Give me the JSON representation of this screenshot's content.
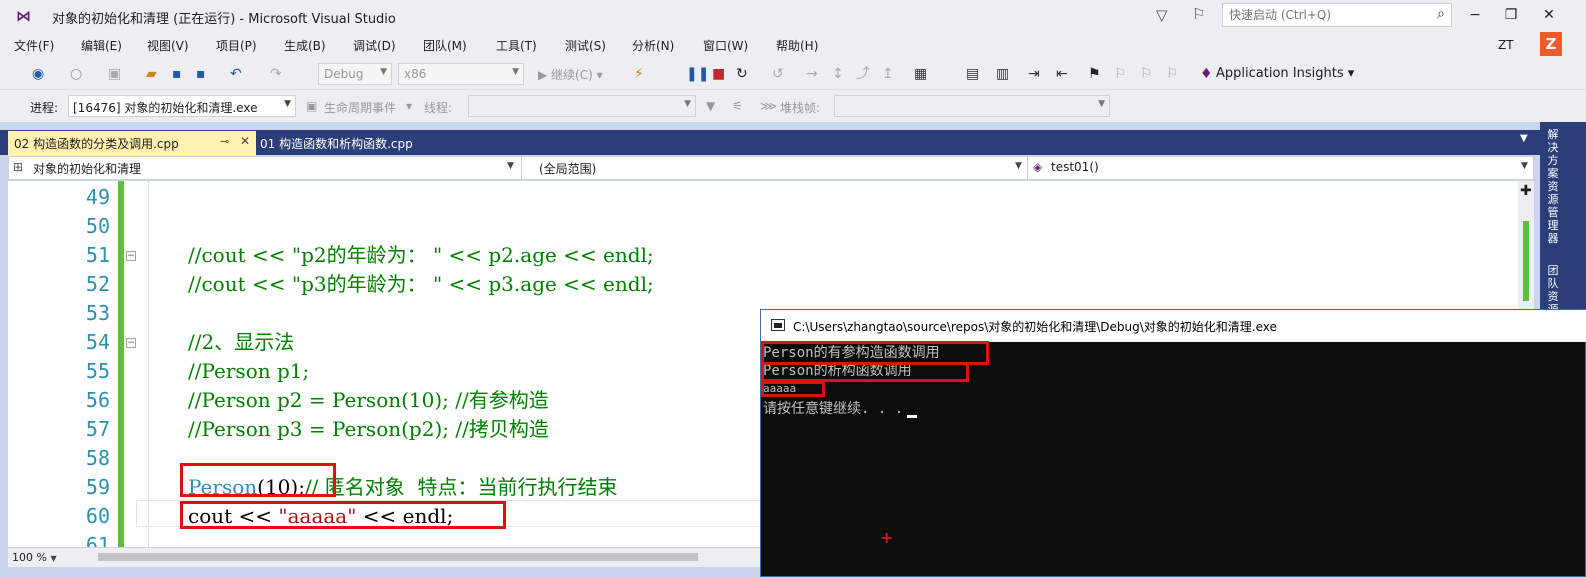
{
  "window": {
    "title": "对象的初始化和清理 (正在运行) - Microsoft Visual Studio",
    "quick_launch_placeholder": "快速启动 (Ctrl+Q)",
    "user_initials": "ZT",
    "user_badge": "Z",
    "minimize": "−",
    "restore": "❐",
    "close": "✕"
  },
  "menu": {
    "items": [
      "文件(F)",
      "编辑(E)",
      "视图(V)",
      "项目(P)",
      "生成(B)",
      "调试(D)",
      "团队(M)",
      "工具(T)",
      "测试(S)",
      "分析(N)",
      "窗口(W)",
      "帮助(H)"
    ]
  },
  "toolbar": {
    "config": "Debug",
    "platform": "x86",
    "continue": "▶ 继续(C) ▾",
    "app_insights": "Application Insights ▾"
  },
  "debug_toolbar": {
    "process_label": "进程:",
    "process_value": "[16476] 对象的初始化和清理.exe",
    "lifecycle_label": "生命周期事件",
    "thread_label": "线程:",
    "stackframe_label": "堆栈帧:"
  },
  "tabs": {
    "active": "02 构造函数的分类及调用.cpp",
    "inactive": "01 构造函数和析构函数.cpp"
  },
  "navbar": {
    "project": "对象的初始化和清理",
    "scope": "(全局范围)",
    "member": "test01()"
  },
  "editor": {
    "line_numbers": [
      "49",
      "50",
      "51",
      "52",
      "53",
      "54",
      "55",
      "56",
      "57",
      "58",
      "59",
      "60",
      "61"
    ],
    "lines": {
      "l51": "//cout << \"p2的年龄为： \" << p2.age << endl;",
      "l52": "//cout << \"p3的年龄为： \" << p3.age << endl;",
      "l54": "//2、显示法",
      "l55": "//Person p1;",
      "l56": "//Person p2 = Person(10); //有参构造",
      "l57": "//Person p3 = Person(p2); //拷贝构造",
      "l59_type": "Person",
      "l59_args": "(10);",
      "l59_comment": "// 匿名对象  特点：当前行执行结束",
      "l60_a": "cout << ",
      "l60_str": "\"aaaaa\"",
      "l60_b": " << endl;"
    },
    "zoom": "100 %"
  },
  "side_panel": {
    "tab1": "解决方案资源管理器",
    "tab2": "团队资源"
  },
  "console": {
    "title": "C:\\Users\\zhangtao\\source\\repos\\对象的初始化和清理\\Debug\\对象的初始化和清理.exe",
    "output": [
      "Person的有参构造函数调用",
      "Person的析构函数调用",
      "aaaaa",
      "请按任意键继续. . ."
    ]
  },
  "colors": {
    "accent": "#68217a",
    "tab_strip": "#2b3e7a",
    "active_tab": "#fff1b0",
    "annotation": "#e01010",
    "change_bar": "#5bbf3f"
  }
}
